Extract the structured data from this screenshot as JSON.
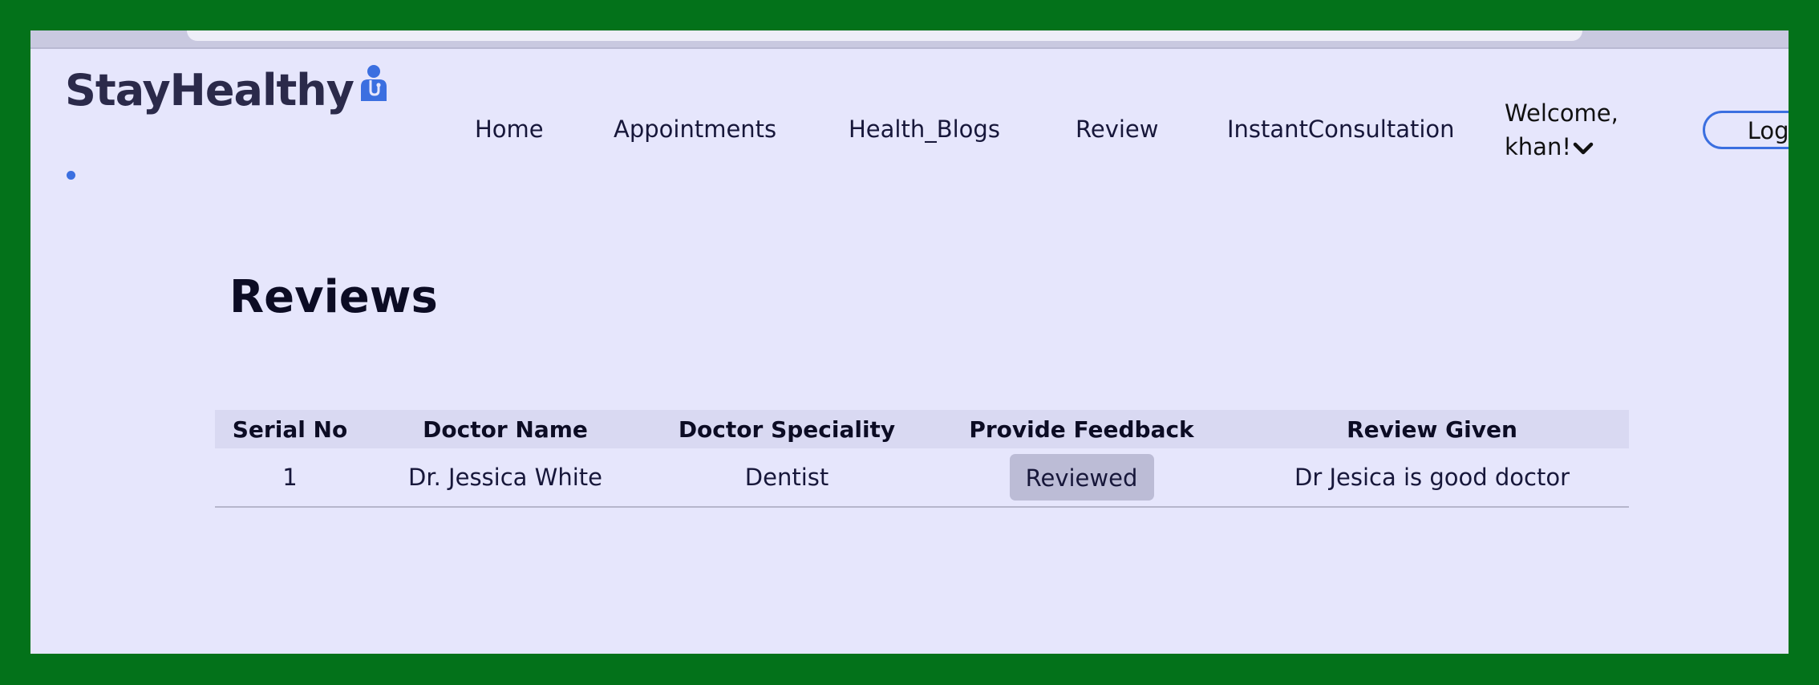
{
  "brand": {
    "name": "StayHealthy"
  },
  "nav": {
    "items": [
      {
        "label": "Home"
      },
      {
        "label": "Appointments"
      },
      {
        "label": "Health_Blogs"
      },
      {
        "label": "Review"
      },
      {
        "label": "InstantConsultation"
      }
    ],
    "welcome_line1": "Welcome,",
    "welcome_line2": "khan!",
    "logout_label": "Logo"
  },
  "page": {
    "title": "Reviews"
  },
  "table": {
    "headers": [
      "Serial No",
      "Doctor Name",
      "Doctor Speciality",
      "Provide Feedback",
      "Review Given"
    ],
    "rows": [
      {
        "serial": "1",
        "doctor": "Dr. Jessica White",
        "speciality": "Dentist",
        "feedback_button": "Reviewed",
        "review": "Dr Jesica is good doctor"
      }
    ]
  },
  "colors": {
    "outer_frame": "#03721a",
    "page_background": "#e6e6fc",
    "accent": "#3b6fe0",
    "text_dark": "#0c0c24"
  },
  "icons": [
    "doctor-icon",
    "chevron-down-icon"
  ]
}
